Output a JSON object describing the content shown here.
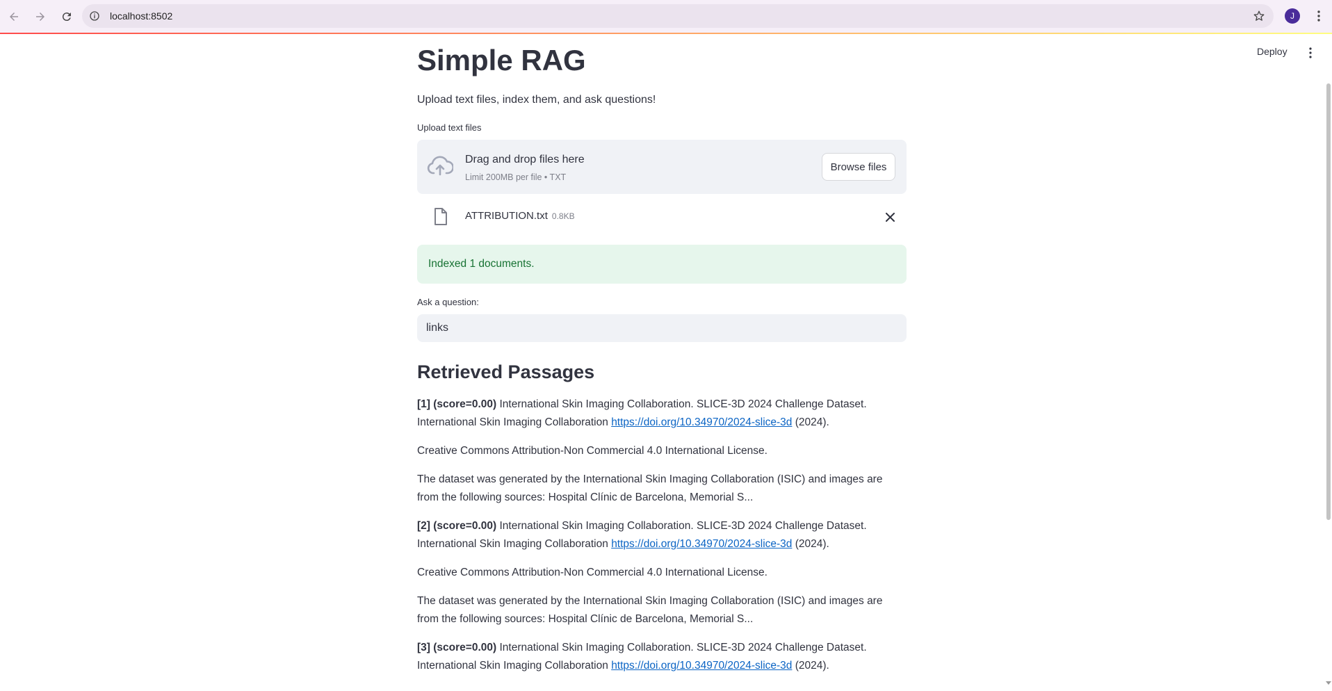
{
  "browser": {
    "url": "localhost:8502",
    "avatar_initial": "J"
  },
  "header": {
    "deploy_label": "Deploy"
  },
  "app": {
    "title": "Simple RAG",
    "subtitle": "Upload text files, index them, and ask questions!",
    "uploader": {
      "label": "Upload text files",
      "drop_title": "Drag and drop files here",
      "drop_limit": "Limit 200MB per file • TXT",
      "browse_label": "Browse files"
    },
    "file": {
      "name": "ATTRIBUTION.txt",
      "size": "0.8KB"
    },
    "status": {
      "message": "Indexed 1 documents."
    },
    "question": {
      "label": "Ask a question:",
      "value": "links"
    },
    "results": {
      "heading": "Retrieved Passages",
      "passages": [
        {
          "num": "[1]",
          "score": "(score=0.00)",
          "text_a": "International Skin Imaging Collaboration. SLICE-3D 2024 Challenge Dataset. International Skin Imaging Collaboration",
          "link": "https://doi.org/10.34970/2024-slice-3d",
          "text_b": "(2024).",
          "license": "Creative Commons Attribution-Non Commercial 4.0 International License.",
          "description": "The dataset was generated by the International Skin Imaging Collaboration (ISIC) and images are from the following sources: Hospital Clínic de Barcelona, Memorial S..."
        },
        {
          "num": "[2]",
          "score": "(score=0.00)",
          "text_a": "International Skin Imaging Collaboration. SLICE-3D 2024 Challenge Dataset. International Skin Imaging Collaboration",
          "link": "https://doi.org/10.34970/2024-slice-3d",
          "text_b": "(2024).",
          "license": "Creative Commons Attribution-Non Commercial 4.0 International License.",
          "description": "The dataset was generated by the International Skin Imaging Collaboration (ISIC) and images are from the following sources: Hospital Clínic de Barcelona, Memorial S..."
        },
        {
          "num": "[3]",
          "score": "(score=0.00)",
          "text_a": "International Skin Imaging Collaboration. SLICE-3D 2024 Challenge Dataset. International Skin Imaging Collaboration",
          "link": "https://doi.org/10.34970/2024-slice-3d",
          "text_b": "(2024)."
        }
      ]
    }
  },
  "icons": {
    "back": "arrow-left-icon",
    "forward": "arrow-right-icon",
    "reload": "reload-icon",
    "site_info": "info-icon",
    "bookmark": "star-icon",
    "menu": "vertical-dots-icon",
    "upload": "cloud-upload-icon",
    "file": "file-icon",
    "remove": "close-icon"
  },
  "colors": {
    "accent_start": "#ff4b4b",
    "accent_end": "#fffd80",
    "success_bg": "#e6f6ec",
    "success_text": "#177233",
    "link": "#0b64c4"
  }
}
